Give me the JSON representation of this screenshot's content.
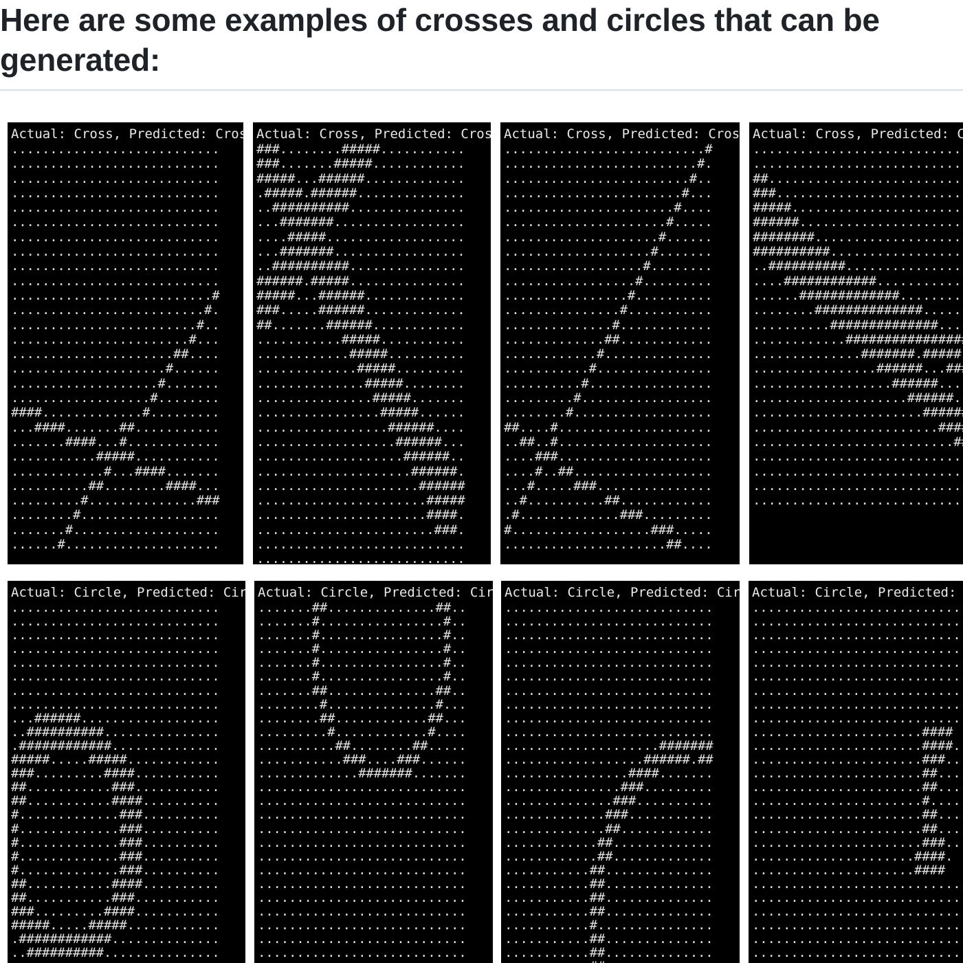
{
  "heading": "Here are some examples of crosses and circles that can be generated:",
  "panels": [
    {
      "title": "Actual: Cross, Predicted: Cross",
      "rows": [
        "...........................",
        "...........................",
        "...........................",
        "...........................",
        "...........................",
        "...........................",
        "...........................",
        "...........................",
        "...........................",
        "...........................",
        "..........................#",
        ".........................#.",
        "........................#..",
        ".......................#...",
        ".....................##....",
        "....................#......",
        "...................#.......",
        "..................#........",
        "####.............#.........",
        "...####.......##...........",
        ".......####...#............",
        "...........#####...........",
        "............#...####.......",
        "..........##........####...",
        ".........#..............###",
        "........#..................",
        ".......#...................",
        "......#...................."
      ]
    },
    {
      "title": "Actual: Cross, Predicted: Cross",
      "rows": [
        "###........#####...........",
        "###.......#####............",
        "#####...######.............",
        ".#####.######..............",
        "..##########...............",
        "...#######.................",
        "....#####..................",
        "...#######.................",
        "..##########...............",
        "######.#####...............",
        "#####...######.............",
        "###.....######.............",
        "##.......######............",
        "...........#####...........",
        "............#####..........",
        ".............#####.........",
        "..............#####........",
        "...............#####.......",
        "................#####......",
        ".................######....",
        "..................######...",
        "...................######..",
        "....................######.",
        ".....................######",
        "......................#####",
        "......................####.",
        ".......................###.",
        "...........................",
        "..........................."
      ]
    },
    {
      "title": "Actual: Cross, Predicted: Cross",
      "rows": [
        "..........................#",
        ".........................#.",
        "........................#..",
        ".......................#...",
        "......................#....",
        ".....................#.....",
        "....................#......",
        "...................#.......",
        "..................#........",
        ".................#.........",
        "................#..........",
        "...............#...........",
        "..............#............",
        ".............##............",
        "............#..............",
        "...........#...............",
        "..........#................",
        ".........#.................",
        "........#..................",
        "##....#....................",
        "..##..#....................",
        "....###....................",
        "....#..##..................",
        "...#.....###...............",
        "..#..........##............",
        ".#.............###.........",
        "#..................###.....",
        ".....................##...."
      ]
    },
    {
      "title": "Actual: Cross, Predicted: Cr",
      "rows": [
        "...........................",
        "...........................",
        "##.........................",
        "###........................",
        "#####......................",
        "######.....................",
        "########...................",
        "##########.................",
        "..##########...............",
        "....############...........",
        "......#############........",
        "........##############.....",
        "..........##############...",
        "............################",
        "..............#######.#####",
        "................######...###",
        "..................######....",
        "....................######..",
        "......................######",
        "........................######",
        "..........................####",
        "............................###",
        "..............................##",
        "...........................",
        "..........................."
      ]
    },
    {
      "title": "Actual: Circle, Predicted: Circle",
      "rows": [
        "...........................",
        "...........................",
        "...........................",
        "...........................",
        "...........................",
        "...........................",
        "...........................",
        "...........................",
        "...######..................",
        "..##########...............",
        ".############..............",
        "#####.....#####............",
        "###.........####...........",
        "##...........###...........",
        "##...........####..........",
        "#.............###..........",
        "#.............###..........",
        "#.............###..........",
        "#.............###..........",
        "#.............###..........",
        "##...........####..........",
        "##...........###...........",
        "###.........####...........",
        "#####.....#####............",
        ".############..............",
        "..##########..............."
      ]
    },
    {
      "title": "Actual: Circle, Predicted: Circle",
      "rows": [
        ".......##..............##..",
        ".......#................#..",
        ".......#................#..",
        ".......#................#..",
        ".......#................#..",
        ".......#................#..",
        ".......##..............##..",
        "........#..............#...",
        "........##............##...",
        ".........#............#....",
        "..........##........##.....",
        "...........###....###......",
        ".............#######.......",
        "...........................",
        "...........................",
        "...........................",
        "...........................",
        "...........................",
        "...........................",
        "...........................",
        "...........................",
        "...........................",
        "...........................",
        "...........................",
        "...........................",
        "...........................",
        "..........................."
      ]
    },
    {
      "title": "Actual: Circle, Predicted: Circle",
      "rows": [
        "...........................",
        "...........................",
        "...........................",
        "...........................",
        "...........................",
        "...........................",
        "...........................",
        "...........................",
        "...........................",
        "...........................",
        "....................#######",
        "..................######.##",
        "................####.......",
        "...............###.........",
        "..............###..........",
        ".............###...........",
        ".............##............",
        "............##.............",
        "............##.............",
        "...........##..............",
        "...........##..............",
        "...........##..............",
        "...........##..............",
        "...........#...............",
        "...........##..............",
        "...........##..............",
        "...........##.............."
      ]
    },
    {
      "title": "Actual: Circle, Predicted: Cir",
      "rows": [
        "...........................",
        "...........................",
        "...........................",
        "...........................",
        "...........................",
        "...........................",
        "...........................",
        "...........................",
        "...........................",
        "......................####",
        "......................####.",
        "......................###...",
        "......................##....",
        "......................##....",
        "......................#.....",
        "......................##....",
        "......................##....",
        "......................###...",
        ".....................####.",
        ".....................####",
        "...........................",
        "...........................",
        "...........................",
        "...........................",
        "...........................",
        "...........................",
        "..........................."
      ]
    }
  ]
}
